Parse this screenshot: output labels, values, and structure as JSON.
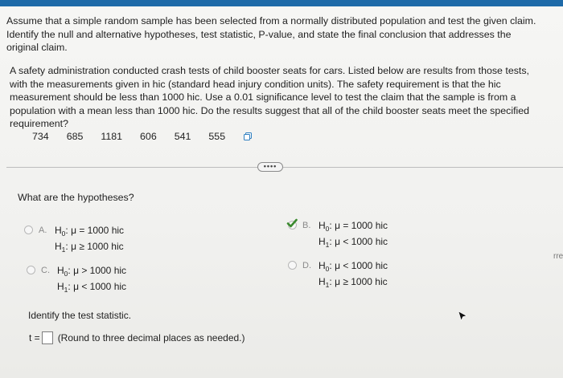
{
  "prompt": {
    "line1": "Assume that a simple random sample has been selected from a normally distributed population and test the given claim.",
    "line2": "Identify the null and alternative hypotheses, test statistic, P-value, and state the final conclusion that addresses the",
    "line3": "original claim."
  },
  "scenario": {
    "line1": "A safety administration conducted crash tests of child booster seats for cars. Listed below are results from those tests,",
    "line2": "with the measurements given in hic (standard head injury condition units). The safety requirement is that the hic",
    "line3": "measurement should be less than 1000 hic. Use a 0.01 significance level to test the claim that the sample is from a",
    "line4": "population with a mean less than 1000 hic. Do the results suggest that all of the child booster seats meet the specified",
    "line5": "requirement?"
  },
  "data_values": [
    "734",
    "685",
    "1181",
    "606",
    "541",
    "555"
  ],
  "more_button": "••••",
  "question1": "What are the hypotheses?",
  "options": {
    "A": {
      "letter": "A.",
      "h0_label": "H",
      "h0_sub": "0",
      "h0_rest": ": μ = 1000 hic",
      "h1_label": "H",
      "h1_sub": "1",
      "h1_rest": ": μ ≥ 1000 hic"
    },
    "B": {
      "letter": "B.",
      "h0_label": "H",
      "h0_sub": "0",
      "h0_rest": ": μ = 1000 hic",
      "h1_label": "H",
      "h1_sub": "1",
      "h1_rest": ": μ < 1000 hic",
      "selected": true
    },
    "C": {
      "letter": "C.",
      "h0_label": "H",
      "h0_sub": "0",
      "h0_rest": ": μ > 1000 hic",
      "h1_label": "H",
      "h1_sub": "1",
      "h1_rest": ": μ < 1000 hic"
    },
    "D": {
      "letter": "D.",
      "h0_label": "H",
      "h0_sub": "0",
      "h0_rest": ": μ < 1000 hic",
      "h1_label": "H",
      "h1_sub": "1",
      "h1_rest": ": μ ≥ 1000 hic"
    }
  },
  "question2": "Identify the test statistic.",
  "answer": {
    "prefix": "t =",
    "hint": "(Round to three decimal places as needed.)"
  },
  "edge_text": "rre",
  "colors": {
    "topbar": "#1e6aa8",
    "check": "#3a8a2e"
  },
  "icons": {
    "copy": "copy-icon",
    "check": "check-icon",
    "cursor": "cursor-icon"
  }
}
